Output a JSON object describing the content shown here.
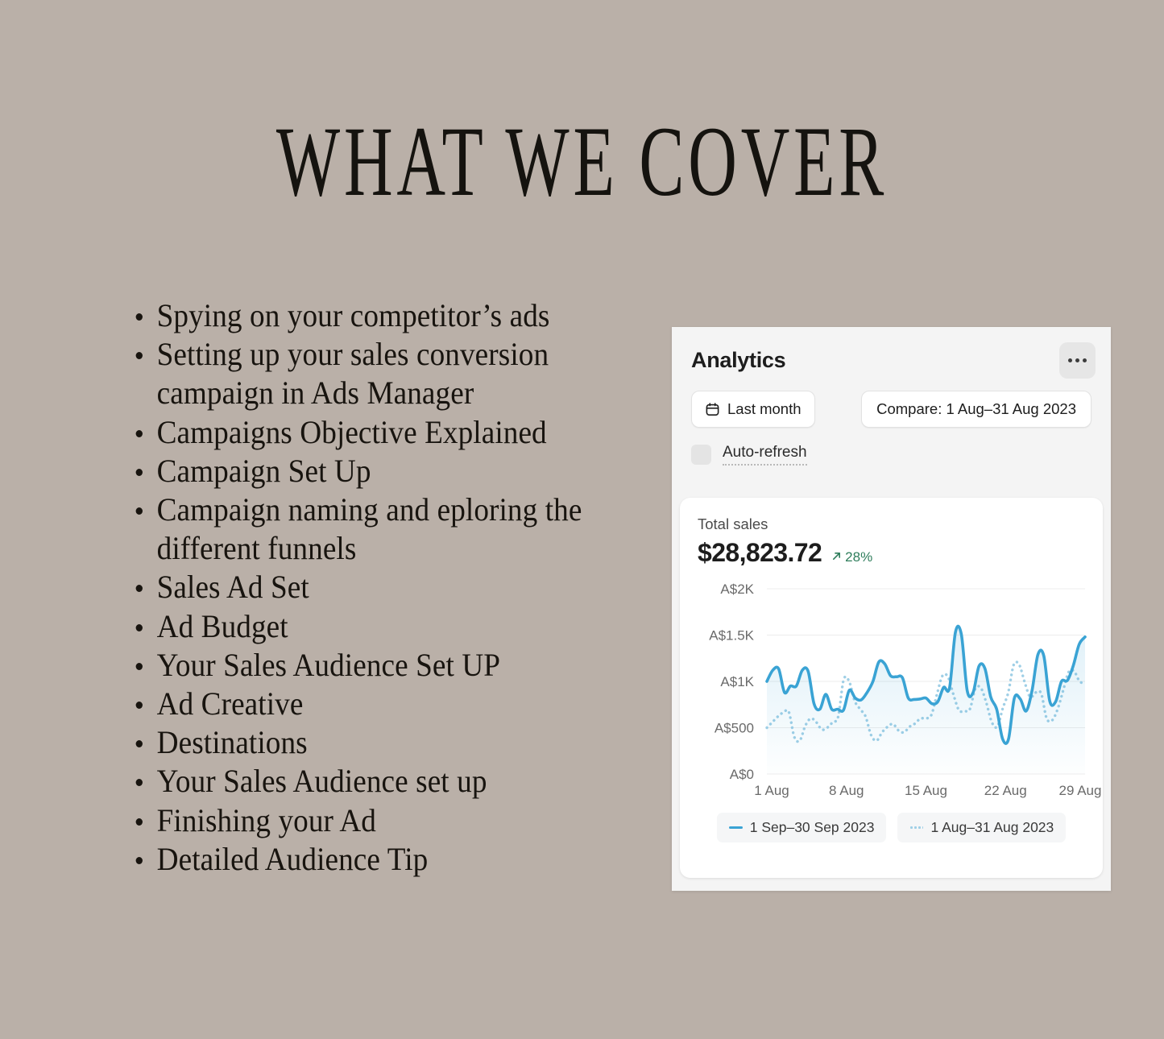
{
  "slide": {
    "title": "WHAT WE COVER",
    "background_color": "#bab0a8",
    "bullets": [
      "Spying on your competitor’s ads",
      "Setting up your sales conversion campaign in Ads Manager",
      "Campaigns Objective Explained",
      "Campaign Set Up",
      "Campaign naming and eploring the different funnels",
      "Sales Ad Set",
      "Ad Budget",
      "Your Sales Audience Set UP",
      "Ad Creative",
      "Destinations",
      "Your Sales Audience set up",
      "Finishing your Ad",
      "Detailed Audience Tip"
    ]
  },
  "analytics": {
    "title": "Analytics",
    "more_icon": "ellipsis-icon",
    "date_range_button": {
      "label": "Last month",
      "icon": "calendar-icon"
    },
    "compare_button": {
      "label": "Compare: 1 Aug–31 Aug 2023"
    },
    "auto_refresh": {
      "label": "Auto-refresh",
      "checked": false
    },
    "metric": {
      "label": "Total sales",
      "value": "$28,823.72",
      "delta": "28%",
      "delta_icon": "arrow-up-right-icon",
      "delta_color": "#2e7d5b"
    },
    "colors": {
      "panel": "#f4f4f4",
      "card": "#ffffff",
      "primary_line": "#3aa3d4",
      "compare_line": "#9fcfe6"
    }
  },
  "chart_data": {
    "type": "line",
    "title": "Total sales",
    "xlabel": "",
    "ylabel": "",
    "ylim": [
      0,
      2000
    ],
    "yticks": [
      0,
      500,
      1000,
      1500,
      2000
    ],
    "ytick_labels": [
      "A$0",
      "A$500",
      "A$1K",
      "A$1.5K",
      "A$2K"
    ],
    "xticks": [
      1,
      8,
      15,
      22,
      29
    ],
    "xtick_labels": [
      "1 Aug",
      "8 Aug",
      "15 Aug",
      "22 Aug",
      "29 Aug"
    ],
    "grid": true,
    "legend_position": "bottom",
    "series": [
      {
        "name": "1 Sep–30 Sep 2023",
        "style": "solid",
        "color": "#3aa3d4",
        "area_fill": true,
        "values": [
          1000,
          1120,
          1135,
          880,
          950,
          950,
          1120,
          1110,
          760,
          700,
          860,
          700,
          700,
          690,
          905,
          820,
          800,
          880,
          1000,
          1210,
          1190,
          1060,
          1050,
          1040,
          820,
          805,
          810,
          820,
          760,
          780,
          935,
          930,
          1530,
          1510,
          900,
          880,
          1165,
          1140,
          830,
          700,
          380,
          375,
          820,
          810,
          680,
          900,
          1290,
          1275,
          790,
          780,
          1000,
          1010,
          1170,
          1400,
          1480
        ]
      },
      {
        "name": "1 Aug–31 Aug 2023",
        "style": "dotted",
        "color": "#9fcfe6",
        "area_fill": false,
        "values": [
          500,
          560,
          620,
          665,
          670,
          400,
          360,
          520,
          600,
          560,
          480,
          500,
          560,
          620,
          1020,
          1000,
          790,
          700,
          620,
          420,
          360,
          450,
          510,
          540,
          470,
          450,
          510,
          545,
          600,
          600,
          640,
          860,
          1060,
          1050,
          860,
          690,
          680,
          700,
          920,
          930,
          770,
          560,
          510,
          710,
          880,
          1180,
          1180,
          990,
          830,
          880,
          870,
          600,
          580,
          700,
          900,
          1100,
          1110,
          1000,
          980
        ]
      }
    ]
  }
}
